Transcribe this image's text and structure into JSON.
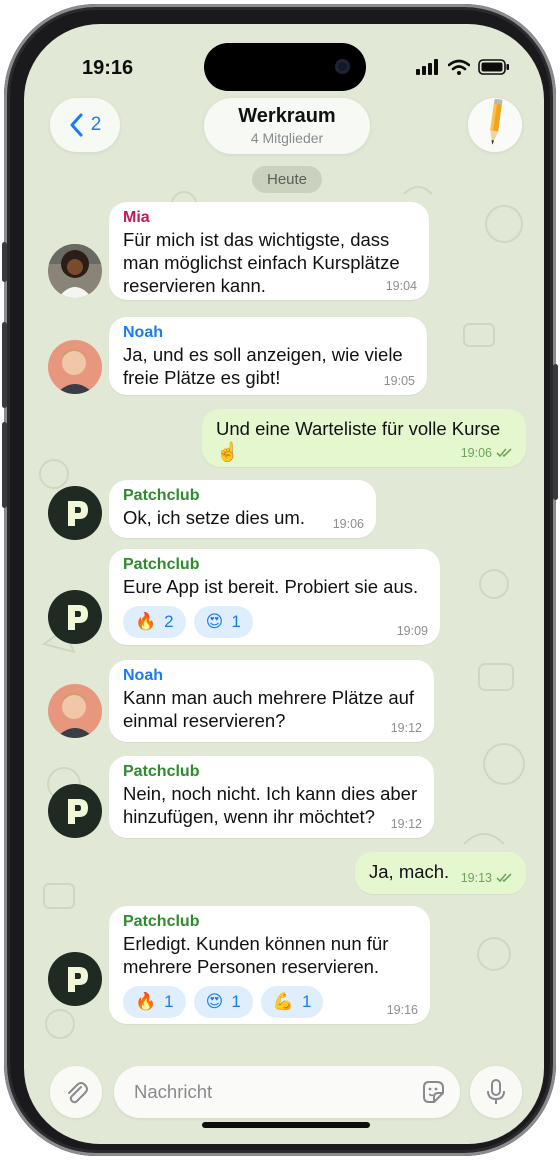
{
  "status_bar": {
    "time": "19:16"
  },
  "header": {
    "back_count": "2",
    "title": "Werkraum",
    "subtitle": "4 Mitglieder"
  },
  "date_separator": "Heute",
  "messages": [
    {
      "sender": "Mia",
      "text": "Für mich ist das wichtigste, dass man möglichst einfach Kursplätze reservieren kann.",
      "time": "19:04"
    },
    {
      "sender": "Noah",
      "text": "Ja, und es soll anzeigen, wie viele freie Plätze es gibt!",
      "time": "19:05"
    },
    {
      "text": "Und eine Warteliste für volle Kurse☝️",
      "time": "19:06"
    },
    {
      "sender": "Patchclub",
      "text": "Ok, ich setze dies um.",
      "time": "19:06"
    },
    {
      "sender": "Patchclub",
      "text": "Eure App ist bereit. Probiert sie aus.",
      "time": "19:09",
      "reactions": [
        {
          "emoji": "🔥",
          "count": "2"
        },
        {
          "emoji": "😍",
          "count": "1"
        }
      ]
    },
    {
      "sender": "Noah",
      "text": "Kann man auch mehrere Plätze auf einmal reservieren?",
      "time": "19:12"
    },
    {
      "sender": "Patchclub",
      "text": "Nein, noch nicht. Ich kann dies aber hinzufügen, wenn ihr möchtet?",
      "time": "19:12"
    },
    {
      "text": "Ja, mach.",
      "time": "19:13"
    },
    {
      "sender": "Patchclub",
      "text": "Erledigt. Kunden können nun für mehrere Personen reservieren.",
      "time": "19:16",
      "reactions": [
        {
          "emoji": "🔥",
          "count": "1"
        },
        {
          "emoji": "😍",
          "count": "1"
        },
        {
          "emoji": "💪",
          "count": "1"
        }
      ]
    }
  ],
  "composer": {
    "placeholder": "Nachricht"
  },
  "colors": {
    "accent": "#1a7cf5",
    "sender_mia": "#c2185b",
    "sender_noah": "#1a7cf5",
    "sender_patchclub": "#2e8b2e",
    "incoming_bubble": "#ffffff",
    "outgoing_bubble": "#e5f7cf",
    "chat_background": "#e1e9d6"
  }
}
